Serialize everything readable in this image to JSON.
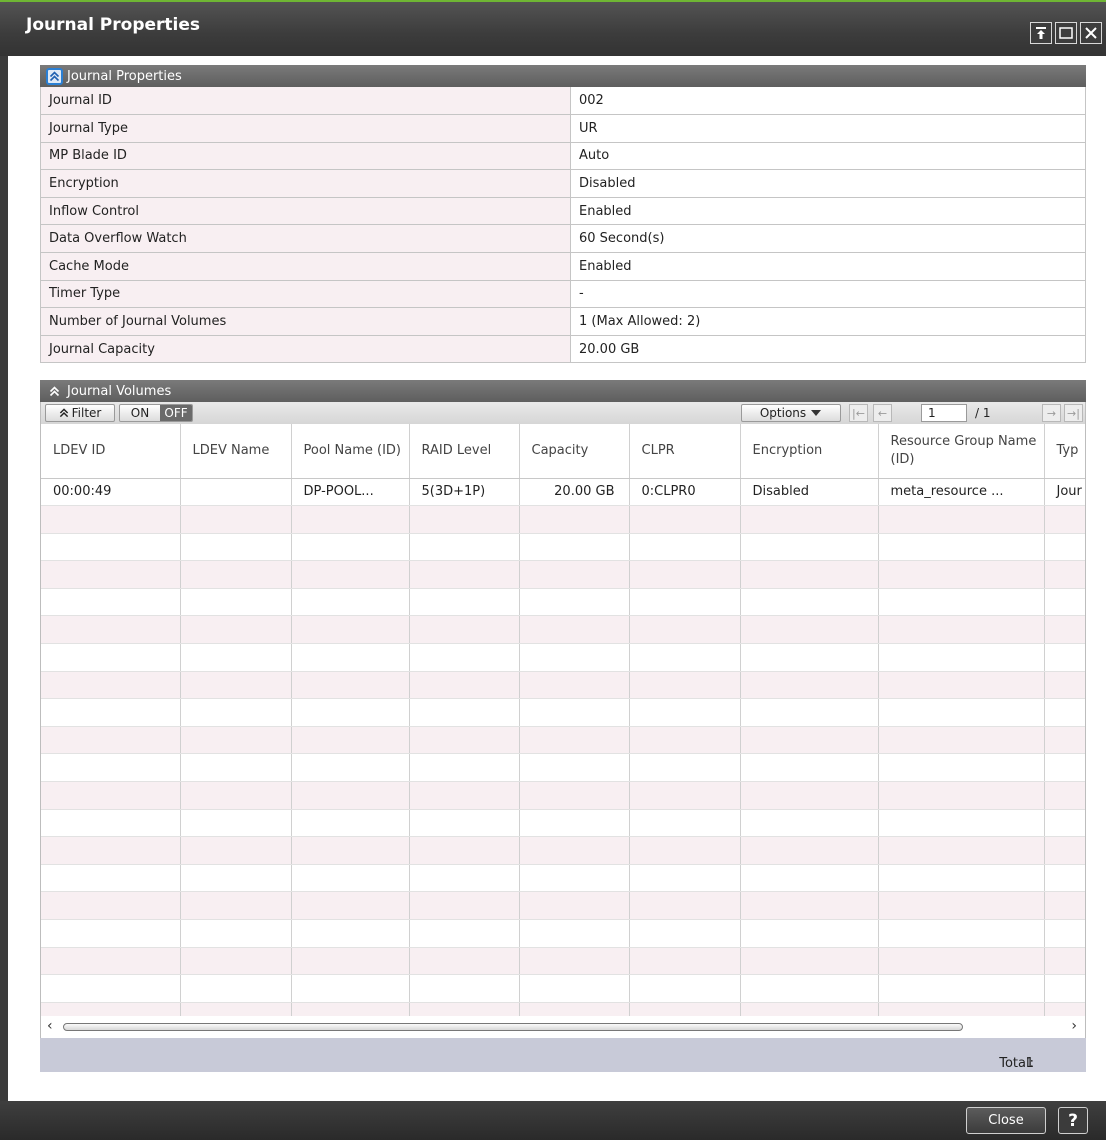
{
  "window": {
    "title": "Journal Properties"
  },
  "properties_section": {
    "header": "Journal Properties",
    "rows": [
      {
        "label": "Journal ID",
        "value": "002"
      },
      {
        "label": "Journal Type",
        "value": "UR"
      },
      {
        "label": "MP Blade ID",
        "value": "Auto"
      },
      {
        "label": "Encryption",
        "value": "Disabled"
      },
      {
        "label": "Inflow Control",
        "value": "Enabled"
      },
      {
        "label": "Data Overflow Watch",
        "value": "60 Second(s)"
      },
      {
        "label": "Cache Mode",
        "value": "Enabled"
      },
      {
        "label": "Timer Type",
        "value": "-"
      },
      {
        "label": "Number of Journal Volumes",
        "value": "1 (Max Allowed: 2)"
      },
      {
        "label": "Journal Capacity",
        "value": "20.00 GB"
      }
    ]
  },
  "volumes_section": {
    "header": "Journal Volumes",
    "toolbar": {
      "filter_label": "Filter",
      "on_label": "ON",
      "off_label": "OFF",
      "filter_state": "OFF",
      "options_label": "Options",
      "page_value": "1",
      "page_total": "/ 1"
    },
    "columns": [
      "LDEV ID",
      "LDEV Name",
      "Pool Name (ID)",
      "RAID Level",
      "Capacity",
      "CLPR",
      "Encryption",
      "Resource Group Name (ID)",
      "Typ"
    ],
    "rows": [
      [
        "00:00:49",
        "",
        "DP-POOL...",
        "5(3D+1P)",
        "20.00 GB",
        "0:CLPR0",
        "Disabled",
        "meta_resource ...",
        "Jour"
      ]
    ],
    "total_label": "Total:",
    "total_value": "1"
  },
  "footer": {
    "close_label": "Close",
    "help_label": "?"
  }
}
